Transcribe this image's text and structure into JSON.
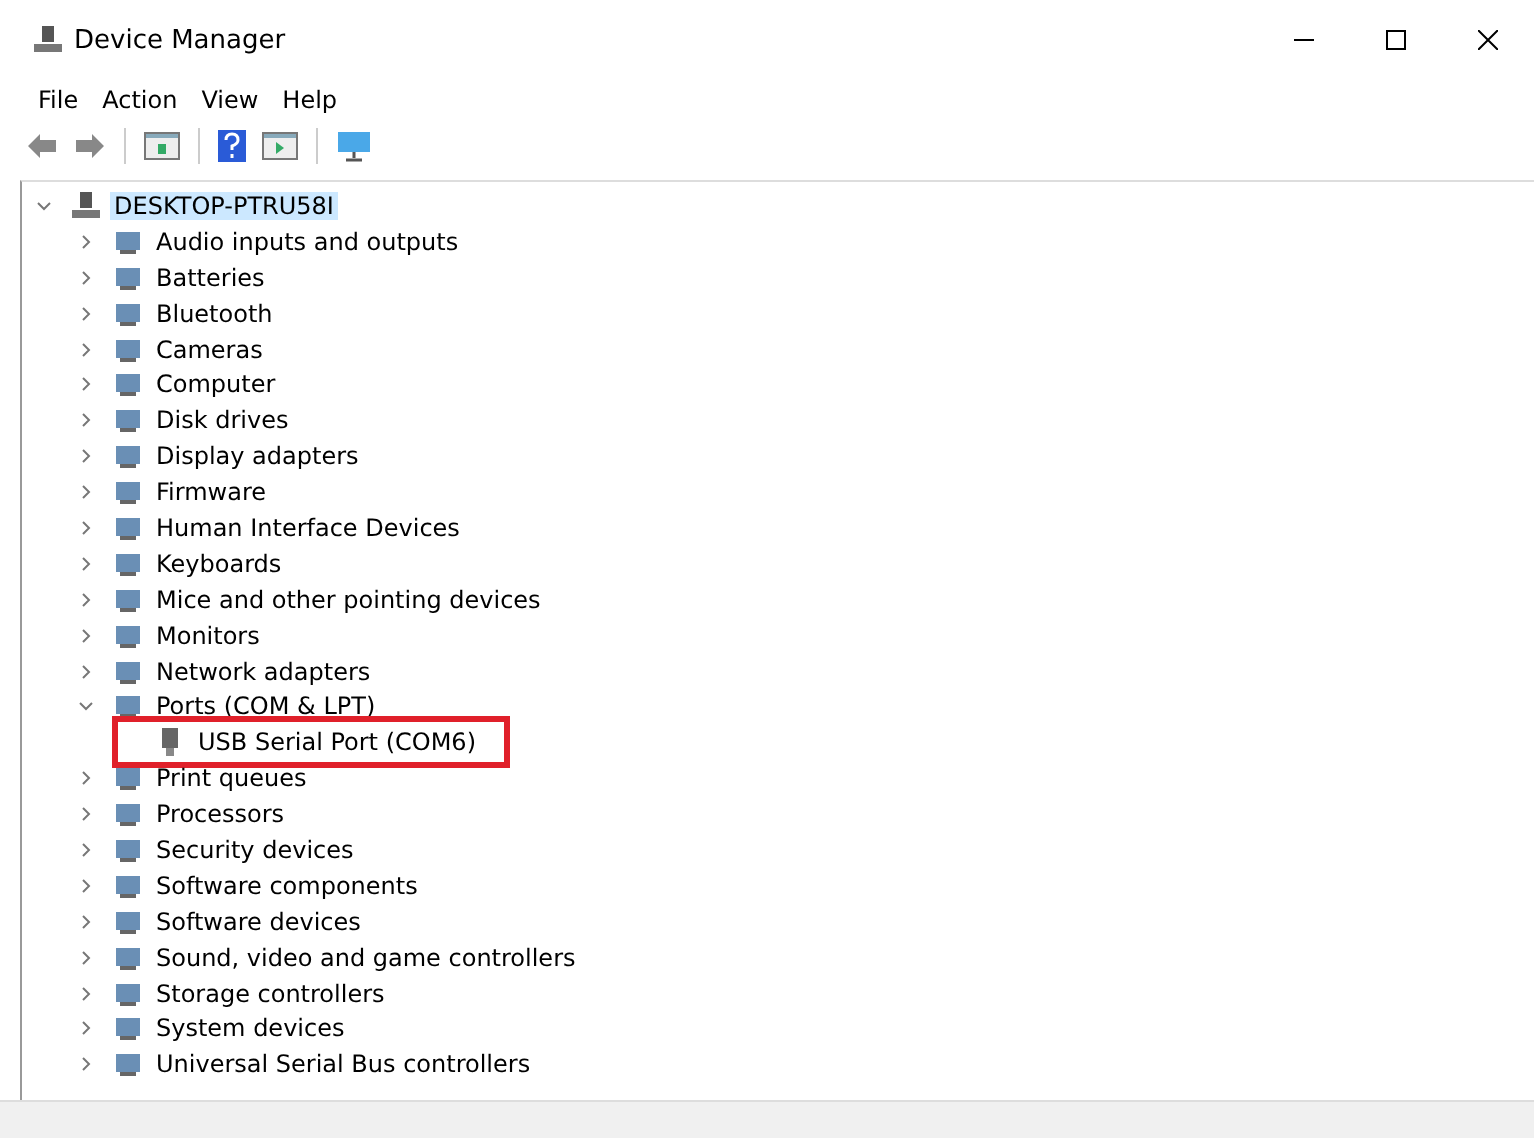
{
  "window": {
    "title": "Device Manager"
  },
  "menu": [
    "File",
    "Action",
    "View",
    "Help"
  ],
  "tree": {
    "label": "DESKTOP-PTRU58I",
    "expanded": true,
    "selected": true,
    "children": [
      {
        "label": "Audio inputs and outputs",
        "expanded": false
      },
      {
        "label": "Batteries",
        "expanded": false
      },
      {
        "label": "Bluetooth",
        "expanded": false
      },
      {
        "label": "Cameras",
        "expanded": false
      },
      {
        "label": "Computer",
        "expanded": false
      },
      {
        "label": "Disk drives",
        "expanded": false
      },
      {
        "label": "Display adapters",
        "expanded": false
      },
      {
        "label": "Firmware",
        "expanded": false
      },
      {
        "label": "Human Interface Devices",
        "expanded": false
      },
      {
        "label": "Keyboards",
        "expanded": false
      },
      {
        "label": "Mice and other pointing devices",
        "expanded": false
      },
      {
        "label": "Monitors",
        "expanded": false
      },
      {
        "label": "Network adapters",
        "expanded": false
      },
      {
        "label": "Ports (COM & LPT)",
        "expanded": true,
        "children": [
          {
            "label": "USB Serial Port (COM6)",
            "highlighted": true
          }
        ]
      },
      {
        "label": "Print queues",
        "expanded": false
      },
      {
        "label": "Processors",
        "expanded": false
      },
      {
        "label": "Security devices",
        "expanded": false
      },
      {
        "label": "Software components",
        "expanded": false
      },
      {
        "label": "Software devices",
        "expanded": false
      },
      {
        "label": "Sound, video and game controllers",
        "expanded": false
      },
      {
        "label": "Storage controllers",
        "expanded": false
      },
      {
        "label": "System devices",
        "expanded": false
      },
      {
        "label": "Universal Serial Bus controllers",
        "expanded": false
      }
    ]
  }
}
